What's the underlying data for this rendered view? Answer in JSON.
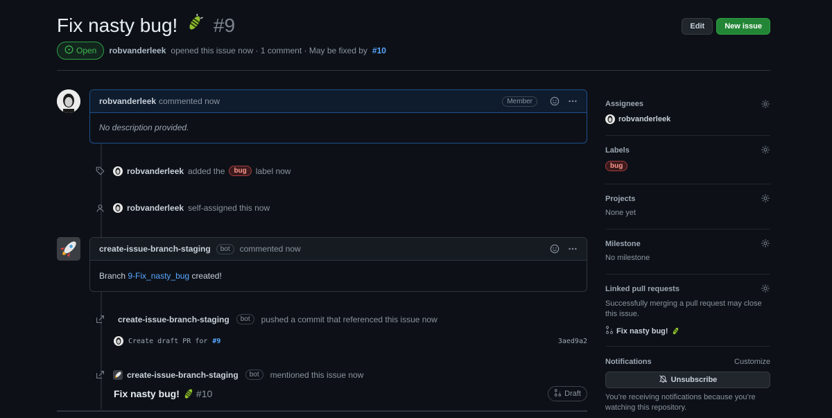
{
  "issue": {
    "title": "Fix nasty bug!",
    "number": "#9",
    "state": "Open",
    "author": "robvanderleek",
    "opened_text": "opened this issue now · 1 comment · May be fixed by",
    "fixed_by": "#10"
  },
  "header": {
    "edit_label": "Edit",
    "new_issue_label": "New issue"
  },
  "first_comment": {
    "author": "robvanderleek",
    "action": "commented now",
    "role": "Member",
    "body": "No description provided."
  },
  "event_label": {
    "author": "robvanderleek",
    "pre": "added the",
    "label": "bug",
    "post": "label now"
  },
  "event_assign": {
    "author": "robvanderleek",
    "text": "self-assigned this now"
  },
  "bot_comment": {
    "author": "create-issue-branch-staging",
    "bot": "bot",
    "action": "commented now",
    "body_pre": "Branch",
    "branch": "9-Fix_nasty_bug",
    "body_post": "created!"
  },
  "event_commit": {
    "author": "create-issue-branch-staging",
    "bot": "bot",
    "text": "pushed a commit that referenced this issue now",
    "message": "Create draft PR for",
    "ref": "#9",
    "sha": "3aed9a2"
  },
  "event_mention": {
    "author": "create-issue-branch-staging",
    "bot": "bot",
    "text": "mentioned this issue now",
    "pr_title": "Fix nasty bug!",
    "pr_number": "#10",
    "draft": "Draft"
  },
  "sidebar": {
    "assignees": {
      "title": "Assignees",
      "user": "robvanderleek"
    },
    "labels": {
      "title": "Labels",
      "label": "bug"
    },
    "projects": {
      "title": "Projects",
      "value": "None yet"
    },
    "milestone": {
      "title": "Milestone",
      "value": "No milestone"
    },
    "linked": {
      "title": "Linked pull requests",
      "desc": "Successfully merging a pull request may close this issue.",
      "pr": "Fix nasty bug!"
    },
    "notifications": {
      "title": "Notifications",
      "customize": "Customize",
      "button": "Unsubscribe",
      "desc": "You’re receiving notifications because you’re watching this repository."
    }
  },
  "colors": {
    "accent": "#58a6ff",
    "open": "#3fb950",
    "primary_button": "#238636",
    "bug_label": "#ff9a8c"
  },
  "icons": [
    "issue-opened-icon",
    "tag-icon",
    "person-icon",
    "cross-reference-icon",
    "smiley-icon",
    "kebab-icon",
    "gear-icon",
    "git-pull-request-icon",
    "bell-slash-icon",
    "bug-emoji-icon",
    "rocket-icon"
  ]
}
